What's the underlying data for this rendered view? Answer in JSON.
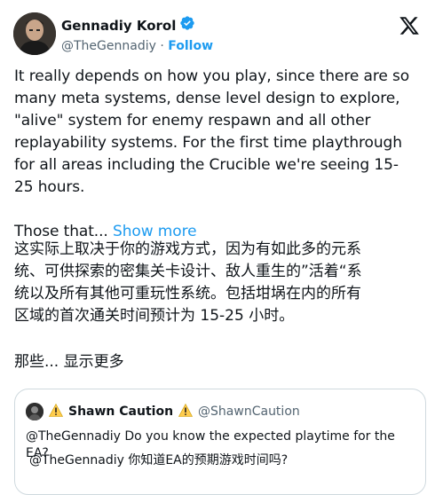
{
  "author": {
    "name": "Gennadiy Korol",
    "handle": "@TheGennadiy",
    "separator": "·",
    "follow_label": "Follow"
  },
  "tweet": {
    "lines": [
      "It really depends on how you play, since there are so",
      "many meta systems, dense level design to explore,",
      "\"alive\" system for enemy respawn and all other",
      "replayability systems. For the first time playthrough",
      "for all areas including the Crucible we're seeing 15-",
      "25 hours."
    ],
    "truncated_text": "Those that...",
    "show_more_label": "Show more"
  },
  "translation": {
    "lines": [
      "这实际上取决于你的游戏方式，因为有如此多的元系",
      "统、可供探索的密集关卡设计、敌人重生的”活着“系",
      "统以及所有其他可重玩性系统。包括坩埚在内的所有",
      "区域的首次通关时间预计为 15-25 小时。"
    ],
    "truncated_text": "那些... 显示更多"
  },
  "quoted_tweet": {
    "warning_symbol": "⚠️",
    "name": "Shawn Caution",
    "handle": "@ShawnCaution",
    "text": "@TheGennadiy Do you know the expected playtime for the EA?",
    "translation": "@TheGennadiy 你知道EA的预期游戏时间吗?"
  },
  "colors": {
    "accent": "#1d9bf0",
    "text": "#0f1419",
    "muted": "#536471",
    "border": "#cfd9de",
    "warning": "#ffcc4d"
  },
  "icons": [
    "verified-badge-icon",
    "x-logo-icon",
    "warning-icon"
  ]
}
